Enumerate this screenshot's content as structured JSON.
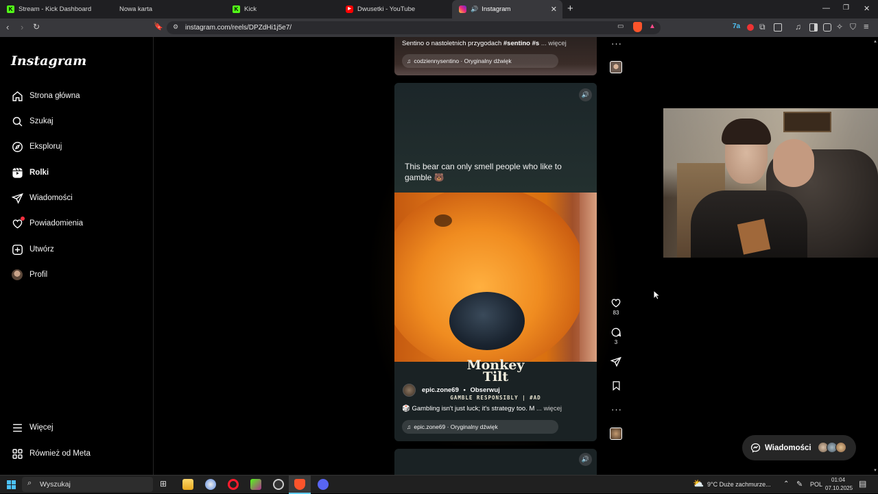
{
  "browser": {
    "tabs": [
      {
        "title": "Stream - Kick Dashboard",
        "icon": "kick-icon",
        "color": "#53fc18"
      },
      {
        "title": "Nowa karta",
        "icon": "none",
        "color": ""
      },
      {
        "title": "Kick",
        "icon": "kick-icon",
        "color": "#53fc18"
      },
      {
        "title": "Dwusetki - YouTube",
        "icon": "youtube-icon",
        "color": "#ff0000"
      },
      {
        "title": "Instagram",
        "icon": "instagram-icon",
        "color": "#e1306c"
      }
    ],
    "active_tab": 4,
    "url": "instagram.com/reels/DPZdHi1j5e7/"
  },
  "sidebar": {
    "logo": "Instagram",
    "items": [
      {
        "label": "Strona główna",
        "icon": "home-icon"
      },
      {
        "label": "Szukaj",
        "icon": "search-icon"
      },
      {
        "label": "Eksploruj",
        "icon": "compass-icon"
      },
      {
        "label": "Rolki",
        "icon": "reels-icon"
      },
      {
        "label": "Wiadomości",
        "icon": "send-icon"
      },
      {
        "label": "Powiadomienia",
        "icon": "heart-icon"
      },
      {
        "label": "Utwórz",
        "icon": "plus-square-icon"
      },
      {
        "label": "Profil",
        "icon": "avatar"
      }
    ],
    "bottom": [
      {
        "label": "Więcej",
        "icon": "menu-icon"
      },
      {
        "label": "Również od Meta",
        "icon": "meta-icon"
      }
    ]
  },
  "prev_reel": {
    "caption": "Sentino o nastoletnich przygodach ",
    "hashtag": "#sentino #s",
    "more": "... więcej",
    "audio": "codziennysentino · Oryginalny dźwięk"
  },
  "reel": {
    "overlay_text": "This bear can only smell people who like to gamble 🐻",
    "brand_line1": "Monkey",
    "brand_line2": "Tilt",
    "brand_sub": "GAMBLE RESPONSIBLY | #AD",
    "username": "epic.zone69",
    "separator": "•",
    "follow": "Obserwuj",
    "caption": "🎲 Gambling isn't just luck; it's strategy too. M",
    "more": "... więcej",
    "audio": "epic.zone69 · Oryginalny dźwięk",
    "likes": "83",
    "comments": "3"
  },
  "messages_pill": {
    "label": "Wiadomości"
  },
  "taskbar": {
    "search_placeholder": "Wyszukaj",
    "weather": "9°C  Duże zachmurze...",
    "language": "POL",
    "time": "01:04",
    "date": "07.10.2025"
  }
}
